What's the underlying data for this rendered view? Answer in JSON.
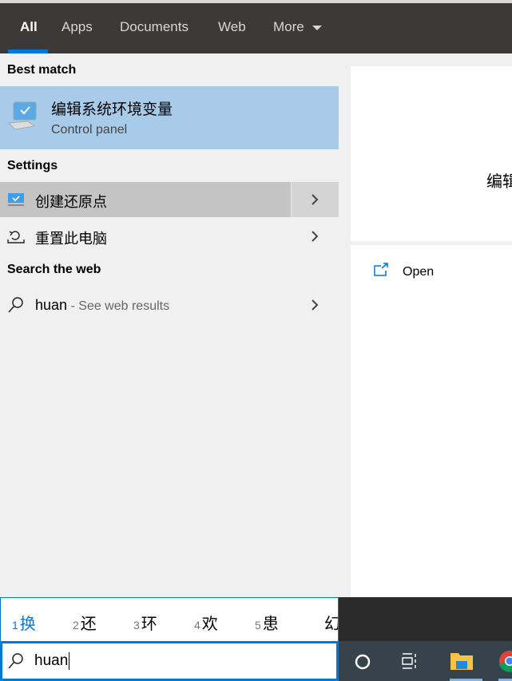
{
  "tabs": [
    {
      "label": "All",
      "active": true
    },
    {
      "label": "Apps"
    },
    {
      "label": "Documents"
    },
    {
      "label": "Web"
    },
    {
      "label": "More"
    }
  ],
  "sections": {
    "best_match": "Best match",
    "settings": "Settings",
    "search_web": "Search the web"
  },
  "best_match": {
    "title": "编辑系统环境变量",
    "subtitle": "Control panel"
  },
  "settings_items": [
    {
      "label": "创建还原点"
    },
    {
      "label": "重置此电脑"
    }
  ],
  "web_result": {
    "query": "huan",
    "suffix": " - See web results"
  },
  "preview": {
    "title": "编辑系统环境变量",
    "open_label": "Open"
  },
  "ime_candidates": [
    {
      "n": "1",
      "c": "换"
    },
    {
      "n": "2",
      "c": "还"
    },
    {
      "n": "3",
      "c": "环"
    },
    {
      "n": "4",
      "c": "欢"
    },
    {
      "n": "5",
      "c": "患"
    },
    {
      "n": "",
      "c": "幻"
    }
  ],
  "search": {
    "value": "huan"
  },
  "colors": {
    "accent": "#0078d7",
    "selected": "#a8cbea",
    "hover": "#c4c4c4",
    "header": "#3b3a39"
  }
}
